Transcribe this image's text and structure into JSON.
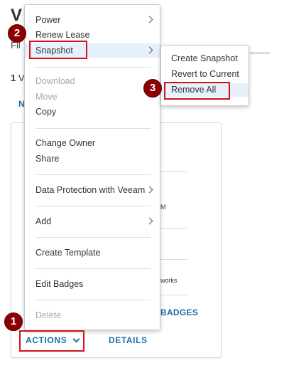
{
  "page": {
    "title_fragment": "V",
    "filter_fragment": "Fil",
    "count_number": "1",
    "count_fragment": "V",
    "tab_fragment": "N"
  },
  "card": {
    "fragments": [
      "M",
      "works"
    ],
    "badges_label": "BADGES",
    "actions_label": "ACTIONS",
    "details_label": "DETAILS"
  },
  "menu": {
    "items": [
      {
        "label": "Power",
        "disabled": false,
        "submenu": true
      },
      {
        "label": "Renew Lease",
        "disabled": false,
        "submenu": false
      },
      {
        "label": "Snapshot",
        "disabled": false,
        "submenu": true,
        "highlighted": true
      },
      {
        "label": "Download",
        "disabled": true,
        "submenu": false
      },
      {
        "label": "Move",
        "disabled": true,
        "submenu": false
      },
      {
        "label": "Copy",
        "disabled": false,
        "submenu": false
      },
      {
        "label": "Change Owner",
        "disabled": false,
        "submenu": false
      },
      {
        "label": "Share",
        "disabled": false,
        "submenu": false
      },
      {
        "label": "Data Protection with Veeam",
        "disabled": false,
        "submenu": true
      },
      {
        "label": "Add",
        "disabled": false,
        "submenu": true
      },
      {
        "label": "Create Template",
        "disabled": false,
        "submenu": false
      },
      {
        "label": "Edit Badges",
        "disabled": false,
        "submenu": false
      },
      {
        "label": "Delete",
        "disabled": true,
        "submenu": false
      }
    ]
  },
  "submenu": {
    "items": [
      {
        "label": "Create Snapshot"
      },
      {
        "label": "Revert to Current"
      },
      {
        "label": "Remove All",
        "highlighted": true
      }
    ]
  },
  "callouts": [
    "1",
    "2",
    "3"
  ],
  "colors": {
    "link": "#1a6ea8",
    "highlight_box": "#d0121b",
    "badge": "#8b0000",
    "menu_hover": "#e7f1fb",
    "disabled_text": "#a8a8a8"
  }
}
